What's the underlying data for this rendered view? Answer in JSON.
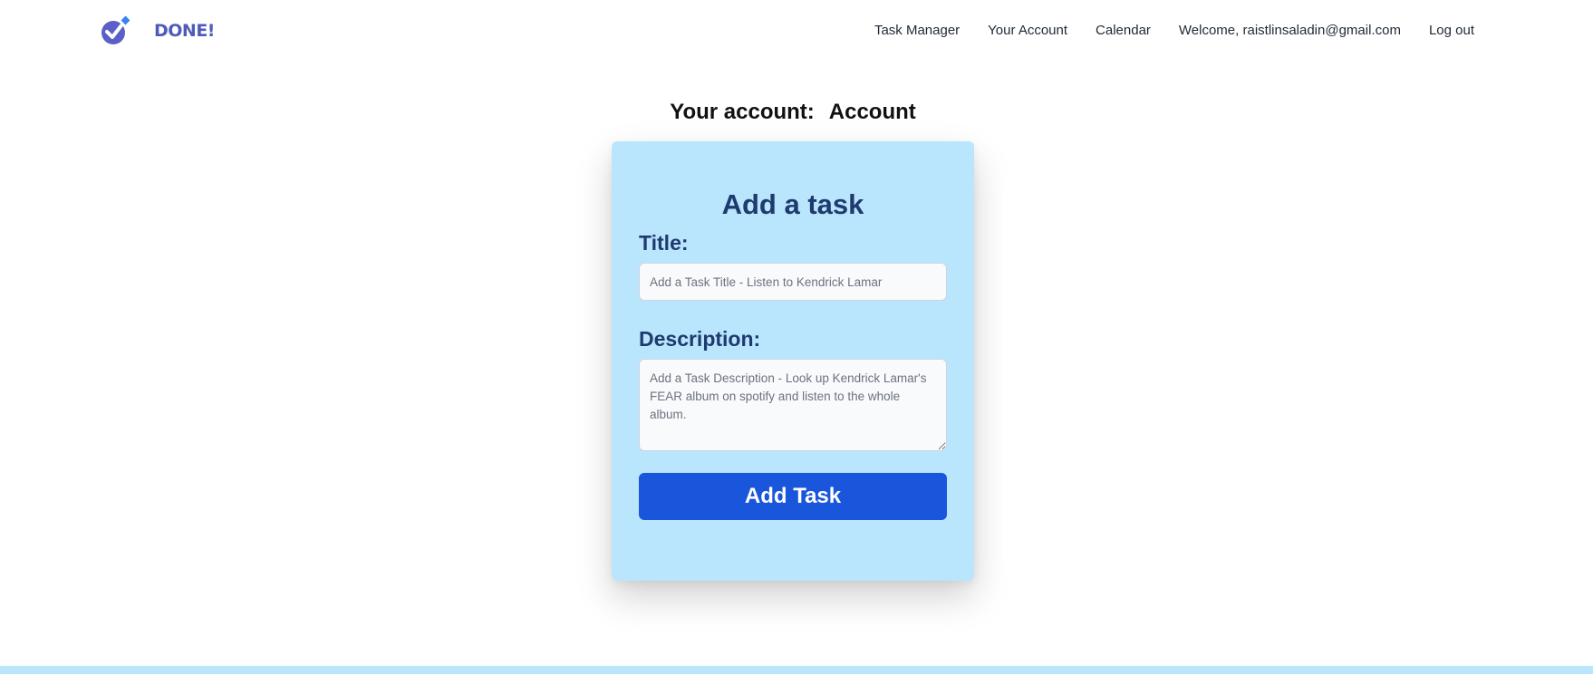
{
  "brand": {
    "name": "DONE!",
    "logo_icon": "check-shield-icon",
    "color": "#4f5bb8"
  },
  "nav": {
    "task_manager": "Task Manager",
    "your_account": "Your Account",
    "calendar": "Calendar",
    "welcome": "Welcome, raistlinsaladin@gmail.com",
    "logout": "Log out"
  },
  "account": {
    "label": "Your account:",
    "name": "Account"
  },
  "form": {
    "heading": "Add a task",
    "title_label": "Title:",
    "title_placeholder": "Add a Task Title - Listen to Kendrick Lamar",
    "title_value": "",
    "description_label": "Description:",
    "description_placeholder": "Add a Task Description - Look up Kendrick Lamar's FEAR album on spotify and listen to the whole album.",
    "description_value": "",
    "submit_label": "Add Task"
  },
  "colors": {
    "card_background": "#bae6fd",
    "heading_text": "#1e3a6e",
    "button_background": "#1a56db",
    "footer_bar": "#bae6fd"
  }
}
